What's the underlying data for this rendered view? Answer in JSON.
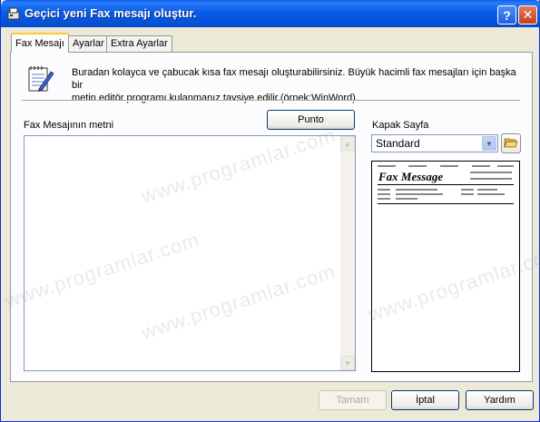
{
  "window": {
    "title": "Geçici yeni Fax mesajı oluştur.",
    "help_glyph": "?",
    "close_glyph": "✕"
  },
  "tabs": [
    {
      "label": "Fax Mesajı",
      "active": true
    },
    {
      "label": "Ayarlar",
      "active": false
    },
    {
      "label": "Extra Ayarlar",
      "active": false
    }
  ],
  "info": {
    "description": "Buradan kolayca ve çabucak kısa fax mesajı oluşturabilirsiniz. Büyük hacimli fax mesajları için başka bir\nmetin editör programı kulanmanız tavsiye edilir.(örnek:WinWord)."
  },
  "message": {
    "label": "Fax Mesajının metni",
    "punto_label": "Punto",
    "value": ""
  },
  "cover": {
    "label": "Kapak Sayfa",
    "selected": "Standard",
    "preview_title": "Fax Message"
  },
  "footer": {
    "ok_label": "Tamam",
    "cancel_label": "İptal",
    "help_label": "Yardım"
  },
  "watermark": "www.programlar.com",
  "colors": {
    "titlebar": "#0a5ce8",
    "tab_highlight": "#ffc83c",
    "panel_bg": "#fcfcfe",
    "window_bg": "#ece9d8"
  }
}
